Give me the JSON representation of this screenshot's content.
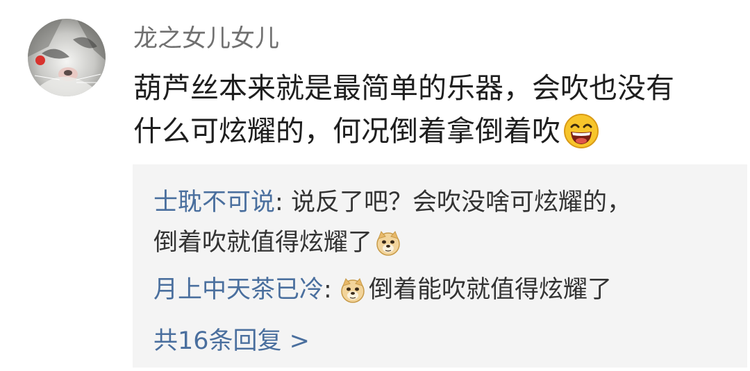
{
  "comment": {
    "username": "龙之女儿女儿",
    "text_line1": "葫芦丝本来就是最简单的乐器，会吹也没有",
    "text_line2": "什么可炫耀的，何况倒着拿倒着吹",
    "trailing_emoji": "laughing-emoji"
  },
  "replies": [
    {
      "name": "士耽不可说",
      "separator": ": ",
      "text_line1": "说反了吧？会吹没啥可炫耀的，",
      "text_line2": "倒着吹就值得炫耀了",
      "emoji": "doge-emoji"
    },
    {
      "name": "月上中天茶已冷",
      "separator": ": ",
      "leading_emoji": "doge-emoji",
      "text_line1": "倒着能吹就值得炫耀了"
    }
  ],
  "more_replies_label": "共16条回复 >",
  "colors": {
    "username": "#707070",
    "comment_text": "#1e1e1e",
    "reply_name": "#4a6f9e",
    "reply_box_bg": "#f4f4f4"
  }
}
